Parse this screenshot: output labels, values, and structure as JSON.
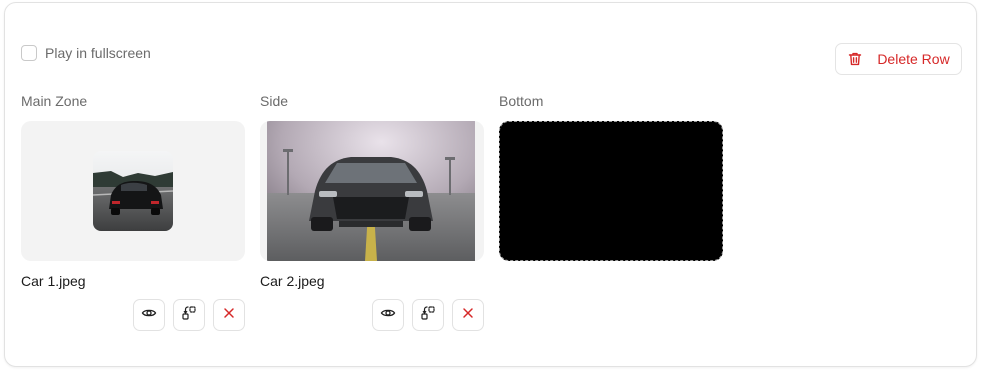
{
  "settings": {
    "fullscreen_label": "Play in fullscreen",
    "fullscreen_checked": false
  },
  "toolbar": {
    "delete_label": "Delete Row"
  },
  "zones": [
    {
      "title": "Main Zone",
      "file_name": "Car 1.jpeg"
    },
    {
      "title": "Side",
      "file_name": "Car 2.jpeg"
    },
    {
      "title": "Bottom",
      "file_name": ""
    }
  ],
  "icons": {
    "delete": "trash-icon",
    "preview": "eye-icon",
    "replace": "replace-icon",
    "remove": "close-icon"
  },
  "colors": {
    "danger": "#d62828",
    "muted_text": "#6b6b6b",
    "zone_bg": "#f3f3f3"
  }
}
